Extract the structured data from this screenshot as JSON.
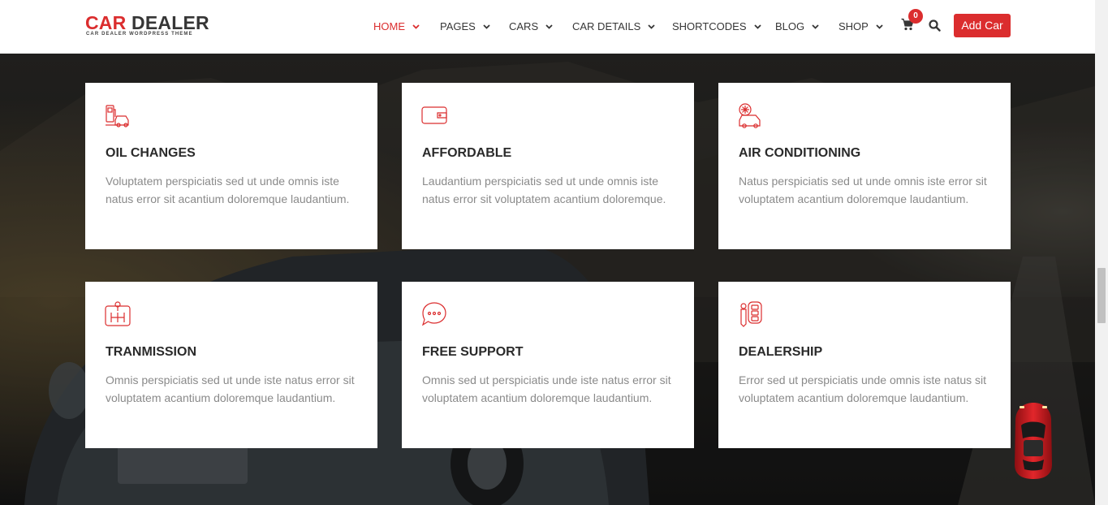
{
  "header": {
    "logo": {
      "part1": "CAR",
      "part2": "DEALER",
      "tagline": "CAR DEALER WORDPRESS THEME"
    },
    "nav": [
      {
        "label": "HOME",
        "active": true
      },
      {
        "label": "PAGES"
      },
      {
        "label": "CARS"
      },
      {
        "label": "CAR DETAILS"
      },
      {
        "label": "SHORTCODES"
      },
      {
        "label": "BLOG"
      },
      {
        "label": "SHOP"
      }
    ],
    "cart_count": "0",
    "add_car_label": "Add Car"
  },
  "services": [
    {
      "icon": "fuel-pump-car-icon",
      "title": "OIL CHANGES",
      "desc": "Voluptatem perspiciatis sed ut unde omnis iste natus error sit acantium doloremque laudantium."
    },
    {
      "icon": "wallet-icon",
      "title": "AFFORDABLE",
      "desc": "Laudantium perspiciatis sed ut unde omnis iste natus error sit voluptatem acantium doloremque."
    },
    {
      "icon": "snowflake-car-icon",
      "title": "AIR CONDITIONING",
      "desc": "Natus perspiciatis sed ut unde omnis iste error sit voluptatem acantium doloremque laudantium."
    },
    {
      "icon": "gear-shift-icon",
      "title": "TRANMISSION",
      "desc": "Omnis perspiciatis sed ut unde iste natus error sit voluptatem acantium doloremque laudantium."
    },
    {
      "icon": "chat-bubble-icon",
      "title": "FREE SUPPORT",
      "desc": "Omnis sed ut perspiciatis unde iste natus error sit voluptatem acantium doloremque laudantium."
    },
    {
      "icon": "car-key-icon",
      "title": "DEALERSHIP",
      "desc": "Error sed ut perspiciatis unde omnis iste natus sit voluptatem acantium doloremque laudantium."
    }
  ],
  "colors": {
    "accent": "#db2d2e",
    "title": "#2a2a2a",
    "text": "#8a8a8a"
  }
}
